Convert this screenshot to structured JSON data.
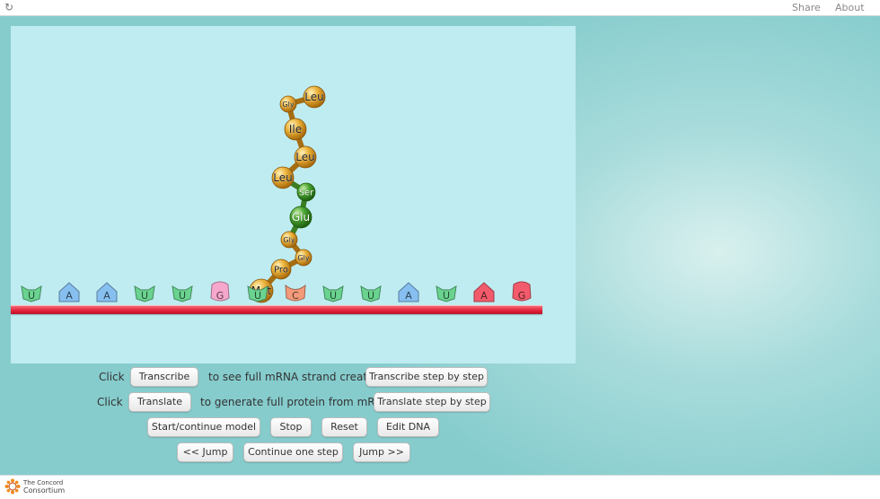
{
  "topbar": {
    "share_label": "Share",
    "about_label": "About"
  },
  "colors": {
    "background": "#9fd6d6",
    "simulation_panel": "#bfecf1",
    "dna_strand": "#e3223a",
    "amino_hydrophobic": "#e1a22a",
    "amino_hydrophilic": "#3f9a2c"
  },
  "mrna_bases": [
    {
      "letter": "U",
      "color": "#6ad38f"
    },
    {
      "letter": "A",
      "color": "#86bff0"
    },
    {
      "letter": "A",
      "color": "#86bff0"
    },
    {
      "letter": "U",
      "color": "#6ad38f"
    },
    {
      "letter": "U",
      "color": "#6ad38f"
    },
    {
      "letter": "G",
      "color": "#f6a7cc"
    },
    {
      "letter": "U",
      "color": "#6ad38f"
    },
    {
      "letter": "C",
      "color": "#f39a7a"
    },
    {
      "letter": "U",
      "color": "#6ad38f"
    },
    {
      "letter": "U",
      "color": "#6ad38f"
    },
    {
      "letter": "A",
      "color": "#86bff0"
    },
    {
      "letter": "U",
      "color": "#6ad38f"
    },
    {
      "letter": "A",
      "color": "#f25b6b"
    },
    {
      "letter": "G",
      "color": "#f25b6b"
    }
  ],
  "protein_chain": [
    {
      "name": "Met",
      "type": "hydrophobic"
    },
    {
      "name": "Pro",
      "type": "hydrophobic"
    },
    {
      "name": "Gly",
      "type": "hydrophobic"
    },
    {
      "name": "Gly",
      "type": "hydrophobic"
    },
    {
      "name": "Glu",
      "type": "hydrophilic"
    },
    {
      "name": "Ser",
      "type": "hydrophilic"
    },
    {
      "name": "Leu",
      "type": "hydrophobic"
    },
    {
      "name": "Leu",
      "type": "hydrophobic"
    },
    {
      "name": "Ile",
      "type": "hydrophobic"
    },
    {
      "name": "Gly",
      "type": "hydrophobic"
    },
    {
      "name": "Leu",
      "type": "hydrophobic"
    }
  ],
  "controls": {
    "click_label_1": "Click",
    "transcribe_label": "Transcribe",
    "transcribe_text": "to see full mRNA strand created or",
    "transcribe_step_label": "Transcribe step by step",
    "click_label_2": "Click",
    "translate_label": "Translate",
    "translate_text": "to generate full protein from mRNA or",
    "translate_step_label": "Translate step by step",
    "start_label": "Start/continue model",
    "stop_label": "Stop",
    "reset_label": "Reset",
    "edit_dna_label": "Edit DNA",
    "jump_back_label": "<< Jump",
    "continue_step_label": "Continue one step",
    "jump_forward_label": "Jump >>"
  },
  "footer": {
    "brand_line_1": "The Concord",
    "brand_line_2": "Consortium"
  }
}
